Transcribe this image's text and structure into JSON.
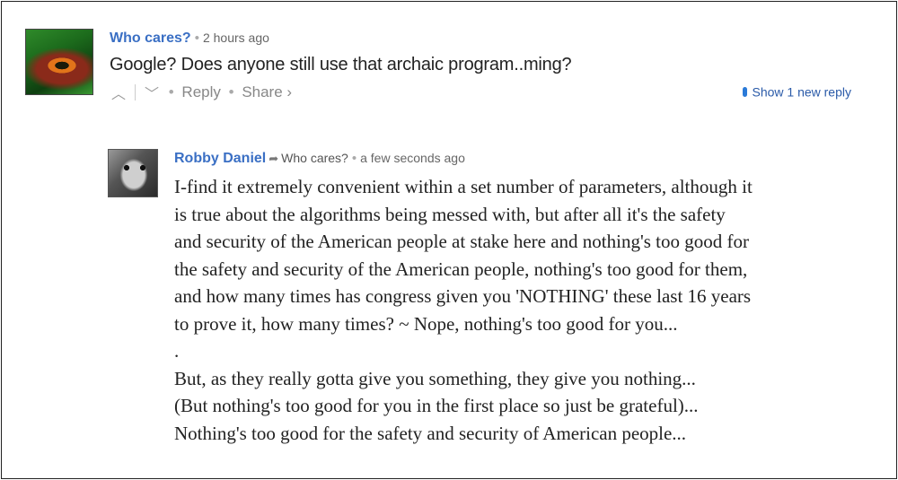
{
  "comment1": {
    "author": "Who cares?",
    "time": "2 hours ago",
    "text": "Google? Does anyone still use that archaic program..ming?",
    "actions": {
      "upvote_icon": "chevron-up-icon",
      "downvote_icon": "chevron-down-icon",
      "reply": "Reply",
      "share": "Share ›",
      "new_reply": "Show 1 new reply"
    }
  },
  "comment2": {
    "author": "Robby Daniel",
    "reply_icon": "reply-arrow-icon",
    "reply_to": "Who cares?",
    "time": "a few seconds ago",
    "text": "I-find it extremely convenient within a set number of parameters, although it\nis true about the algorithms being messed with, but after all it's the safety\nand security of the American people at stake here and nothing's too good for\nthe safety and security of the American people, nothing's too good for them,\nand how many times has congress given you 'NOTHING' these last 16 years\nto prove it, how many times? ~ Nope, nothing's too good for you...\n.\nBut, as they really gotta give you something, they give you nothing...\n(But nothing's too good for you in the first place so just be grateful)...\nNothing's too good for the safety and security of American people..."
  }
}
